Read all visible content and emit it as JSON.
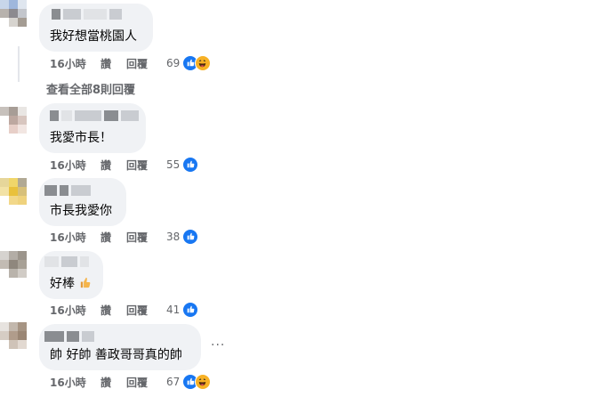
{
  "comments": [
    {
      "text": "我好想當桃園人",
      "time": "16小時",
      "like_label": "讚",
      "reply_label": "回覆",
      "count": "69",
      "reactions": [
        "like-icon",
        "haha-icon"
      ]
    },
    {
      "text": "我愛市長！",
      "time": "16小時",
      "like_label": "讚",
      "reply_label": "回覆",
      "count": "55",
      "reactions": [
        "like-icon"
      ]
    },
    {
      "text": "市長我愛你",
      "time": "16小時",
      "like_label": "讚",
      "reply_label": "回覆",
      "count": "38",
      "reactions": [
        "like-icon"
      ]
    },
    {
      "text": "好棒",
      "emoji": "thumbs-up-icon",
      "time": "16小時",
      "like_label": "讚",
      "reply_label": "回覆",
      "count": "41",
      "reactions": [
        "like-icon"
      ]
    },
    {
      "text": "帥 好帥 善政哥哥真的帥",
      "time": "16小時",
      "like_label": "讚",
      "reply_label": "回覆",
      "count": "67",
      "reactions": [
        "like-icon",
        "haha-icon"
      ]
    }
  ],
  "view_all_replies": "查看全部8則回覆",
  "more_options": "···",
  "colors": {
    "bubble": "#f0f2f5",
    "secondary_text": "#65676b",
    "like_blue": "#1877f2",
    "haha_yellow": "#f7b125"
  }
}
